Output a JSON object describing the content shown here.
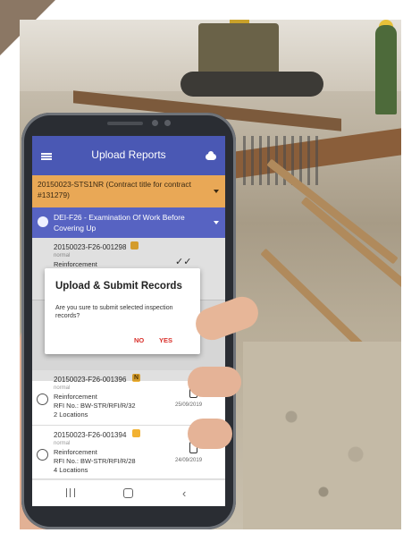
{
  "app": {
    "title": "Upload Reports",
    "contract_selector": "20150023-STS1NR (Contract title for contract #131279)",
    "form_selector": "DEI-F26 - Examination Of Work Before Covering Up"
  },
  "records": [
    {
      "id": "20150023-F26-001298",
      "badge": "",
      "status": "normal",
      "type": "Reinforcement",
      "rfi": "",
      "locations": "",
      "date": "",
      "action_icon": "double-check-icon"
    },
    {
      "id": "20150023-F26-001396",
      "badge": "N",
      "status": "normal",
      "type": "Reinforcement",
      "rfi": "RFI No.: BW-STR/RFI/R/32",
      "locations": "2 Locations",
      "date": "25/09/2019",
      "action_icon": "phone-icon"
    },
    {
      "id": "20150023-F26-001394",
      "badge": "",
      "status": "normal",
      "type": "Reinforcement",
      "rfi": "RFI No.: BW-STR/RFI/R/28",
      "locations": "4 Locations",
      "date": "24/09/2019",
      "action_icon": "phone-icon"
    }
  ],
  "dialog": {
    "title": "Upload & Submit Records",
    "message": "Are you sure to submit selected inspection records?",
    "no_label": "NO",
    "yes_label": "YES"
  },
  "nav_icons": [
    "recents-icon",
    "home-icon",
    "back-icon"
  ],
  "colors": {
    "appbar": "#4a58b4",
    "contract_bar": "#e9a856",
    "form_bar": "#5763c2",
    "dialog_action": "#d9302b",
    "badge": "#f2b233",
    "corner_accent": "#8b7764"
  }
}
